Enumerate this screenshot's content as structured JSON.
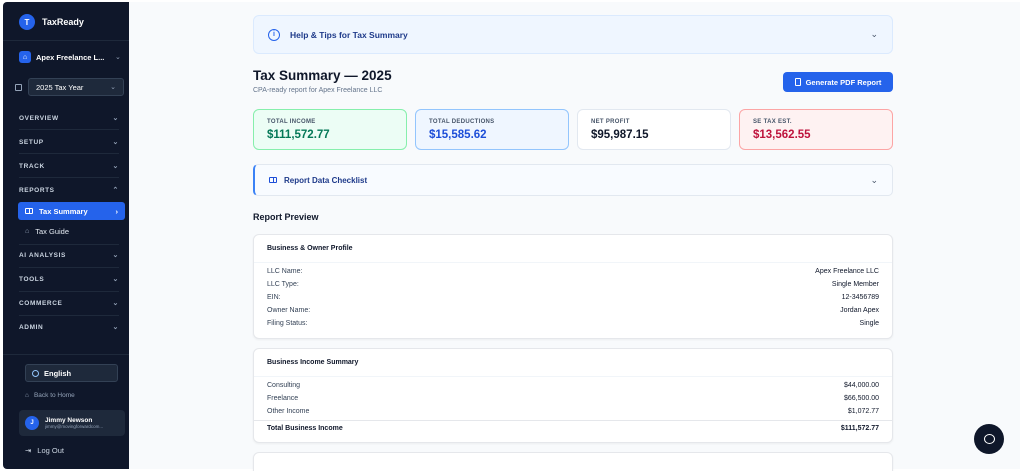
{
  "brand": {
    "name": "TaxReady",
    "logo_letter": "T"
  },
  "org": {
    "name": "Apex Freelance L..."
  },
  "year_select": {
    "value": "2025 Tax Year"
  },
  "nav": {
    "overview": "OVERVIEW",
    "setup": "SETUP",
    "track": "TRACK",
    "reports": "REPORTS",
    "tax_summary": "Tax Summary",
    "tax_guide": "Tax Guide",
    "ai_analysis": "AI ANALYSIS",
    "tools": "TOOLS",
    "commerce": "COMMERCE",
    "admin": "ADMIN"
  },
  "language": "English",
  "back_home": "Back to Home",
  "user": {
    "initial": "J",
    "name": "Jimmy Newson",
    "email": "jimmy@movingforwardcom..."
  },
  "logout": "Log Out",
  "help": {
    "label": "Help & Tips for Tax Summary"
  },
  "page": {
    "title": "Tax Summary — 2025",
    "subtitle": "CPA-ready report for Apex Freelance LLC"
  },
  "generate_button": "Generate PDF Report",
  "stats": {
    "income": {
      "label": "TOTAL INCOME",
      "value": "$111,572.77"
    },
    "deductions": {
      "label": "TOTAL DEDUCTIONS",
      "value": "$15,585.62"
    },
    "profit": {
      "label": "NET PROFIT",
      "value": "$95,987.15"
    },
    "tax": {
      "label": "SE TAX EST.",
      "value": "$13,562.55"
    }
  },
  "checklist": {
    "label": "Report Data Checklist"
  },
  "preview": {
    "title": "Report Preview"
  },
  "profile": {
    "title": "Business & Owner Profile",
    "rows": [
      {
        "label": "LLC Name:",
        "value": "Apex Freelance LLC"
      },
      {
        "label": "LLC Type:",
        "value": "Single Member"
      },
      {
        "label": "EIN:",
        "value": "12-3456789"
      },
      {
        "label": "Owner Name:",
        "value": "Jordan Apex"
      },
      {
        "label": "Filing Status:",
        "value": "Single"
      }
    ]
  },
  "income_summary": {
    "title": "Business Income Summary",
    "rows": [
      {
        "label": "Consulting",
        "value": "$44,000.00"
      },
      {
        "label": "Freelance",
        "value": "$66,500.00"
      },
      {
        "label": "Other Income",
        "value": "$1,072.77"
      }
    ],
    "total": {
      "label": "Total Business Income",
      "value": "$111,572.77"
    }
  }
}
